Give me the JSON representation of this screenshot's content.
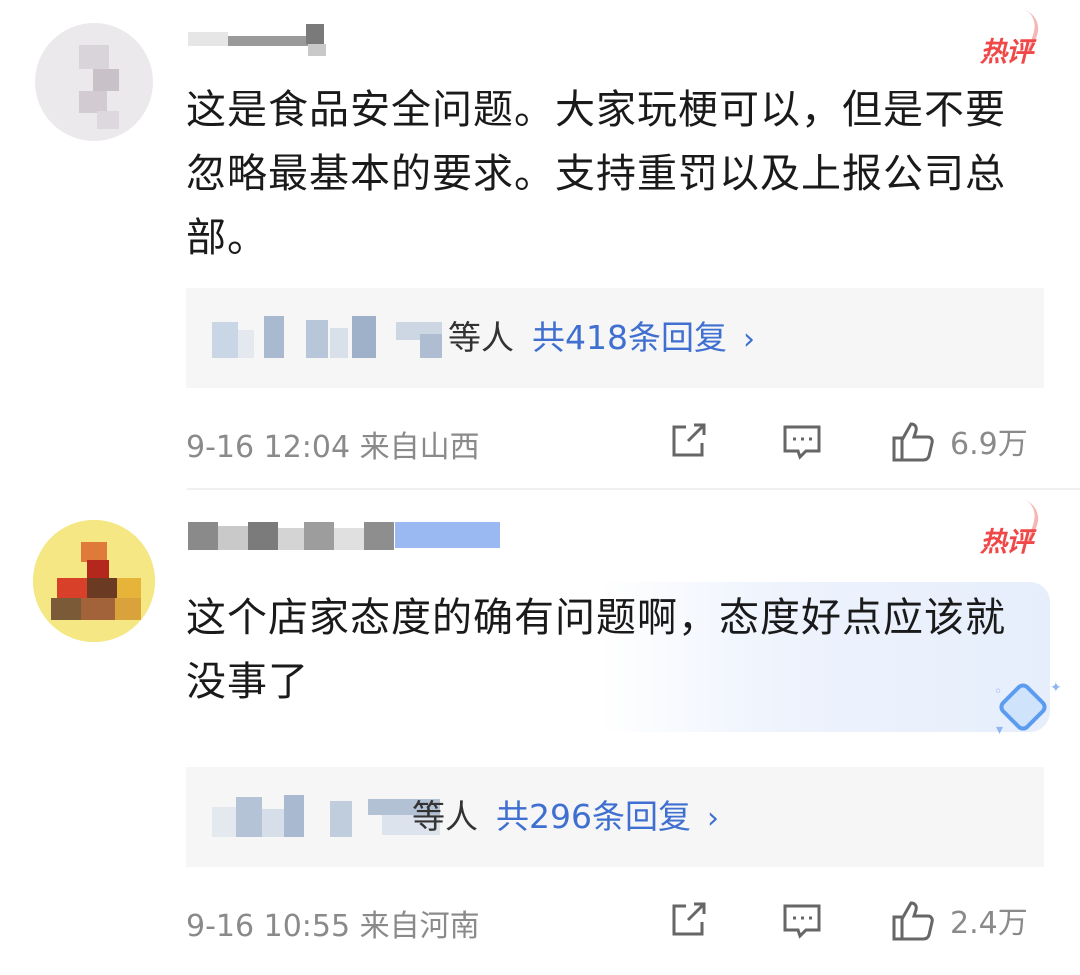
{
  "comments": [
    {
      "hot_label": "热评",
      "text": "这是食品安全问题。大家玩梗可以，但是不要忽略最基本的要求。支持重罚以及上报公司总部。",
      "reply_who": "等人",
      "reply_count": "共418条回复",
      "reply_arrow": "›",
      "meta": "9-16 12:04 来自山西",
      "likes": "6.9万"
    },
    {
      "hot_label": "热评",
      "text": "这个店家态度的确有问题啊，态度好点应该就没事了",
      "reply_who": "等人",
      "reply_count": "共296条回复",
      "reply_arrow": "›",
      "meta": "9-16 10:55 来自河南",
      "likes": "2.4万"
    }
  ],
  "icons": {
    "share": "share-icon",
    "comment": "comment-icon",
    "like": "thumbs-up-icon",
    "hot": "hot-comment-badge",
    "reward": "diamond-icon"
  },
  "colors": {
    "hot_red": "#f04848",
    "reply_blue": "#3f6fd0",
    "meta_gray": "#8a8a8a",
    "reply_bg": "#f6f6f6"
  }
}
